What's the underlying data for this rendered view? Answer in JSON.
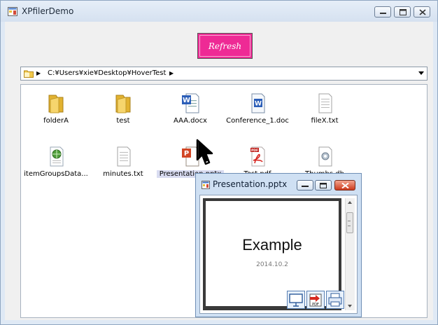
{
  "window": {
    "title": "XPfilerDemo",
    "title_icon": "app-window-icon",
    "controls": [
      "minimize-icon",
      "maximize-icon",
      "close-icon"
    ]
  },
  "toolbar": {
    "refresh_label": "Refresh",
    "refresh_color": "#ee2a95"
  },
  "address_bar": {
    "icon": "folder-icon",
    "path": "C:¥Users¥xie¥Desktop¥HoverTest"
  },
  "files": [
    {
      "name": "folderA",
      "icon": "folder-icon"
    },
    {
      "name": "test",
      "icon": "folder-icon"
    },
    {
      "name": "AAA.docx",
      "icon": "word-document-icon"
    },
    {
      "name": "Conference_1.doc",
      "icon": "word-document-icon"
    },
    {
      "name": "fileX.txt",
      "icon": "text-file-icon"
    },
    {
      "name": "itemGroupsData...",
      "icon": "web-file-icon"
    },
    {
      "name": "minutes.txt",
      "icon": "text-file-icon"
    },
    {
      "name": "Presentation.pptx",
      "icon": "powerpoint-icon",
      "hovered": true
    },
    {
      "name": "Test.pdf",
      "icon": "pdf-icon"
    },
    {
      "name": "Thumbs.db",
      "icon": "database-file-icon"
    }
  ],
  "preview": {
    "title": "Presentation.pptx",
    "slide_title": "Example",
    "slide_date": "2014.10.2",
    "tools": [
      "slideshow-icon",
      "export-pdf-icon",
      "print-icon"
    ],
    "pdf_label": "PDF"
  }
}
